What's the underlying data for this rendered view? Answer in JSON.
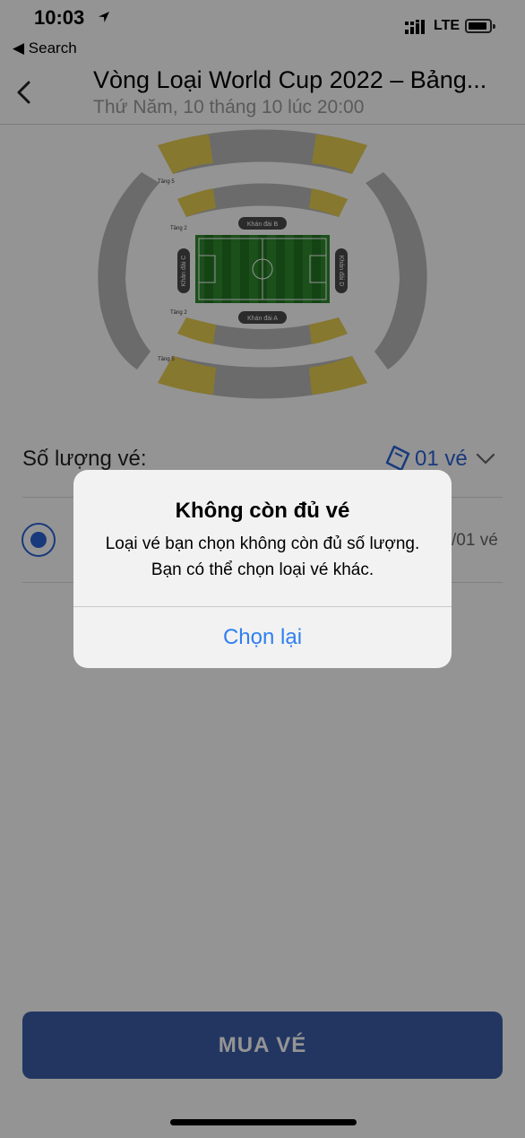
{
  "status_bar": {
    "time": "10:03",
    "back_app": "◀ Search",
    "network": "LTE"
  },
  "nav": {
    "title": "Vòng Loại World Cup 2022 – Bảng...",
    "subtitle": "Thứ Năm, 10 tháng 10 lúc 20:00"
  },
  "stadium": {
    "tier_labels": [
      "Tầng 5",
      "Tầng 2",
      "Tầng 2",
      "Tầng 5"
    ],
    "stands": [
      "Khán đài B",
      "Khán đài A",
      "Khán đài C",
      "Khán đài D"
    ],
    "colors": {
      "highlight": "#e8cf52",
      "seat": "#b8b8b8",
      "pitch": "#2f8a2f",
      "pitch_dark": "#247424",
      "stand_label_bg": "#4a4a4a"
    }
  },
  "quantity": {
    "label": "Số lượng vé:",
    "value": "01 vé",
    "icon": "ticket-icon"
  },
  "ticket_row": {
    "right_text": "/01 vé"
  },
  "buy_button": {
    "label": "MUA VÉ"
  },
  "alert": {
    "title": "Không còn đủ vé",
    "message": "Loại vé bạn chọn không còn đủ số lượng. Bạn có thể chọn loại vé khác.",
    "button": "Chọn lại"
  },
  "colors": {
    "accent": "#2b62d8",
    "alert_button": "#2f7ff0",
    "buy_button_bg": "#3c5ea8"
  }
}
